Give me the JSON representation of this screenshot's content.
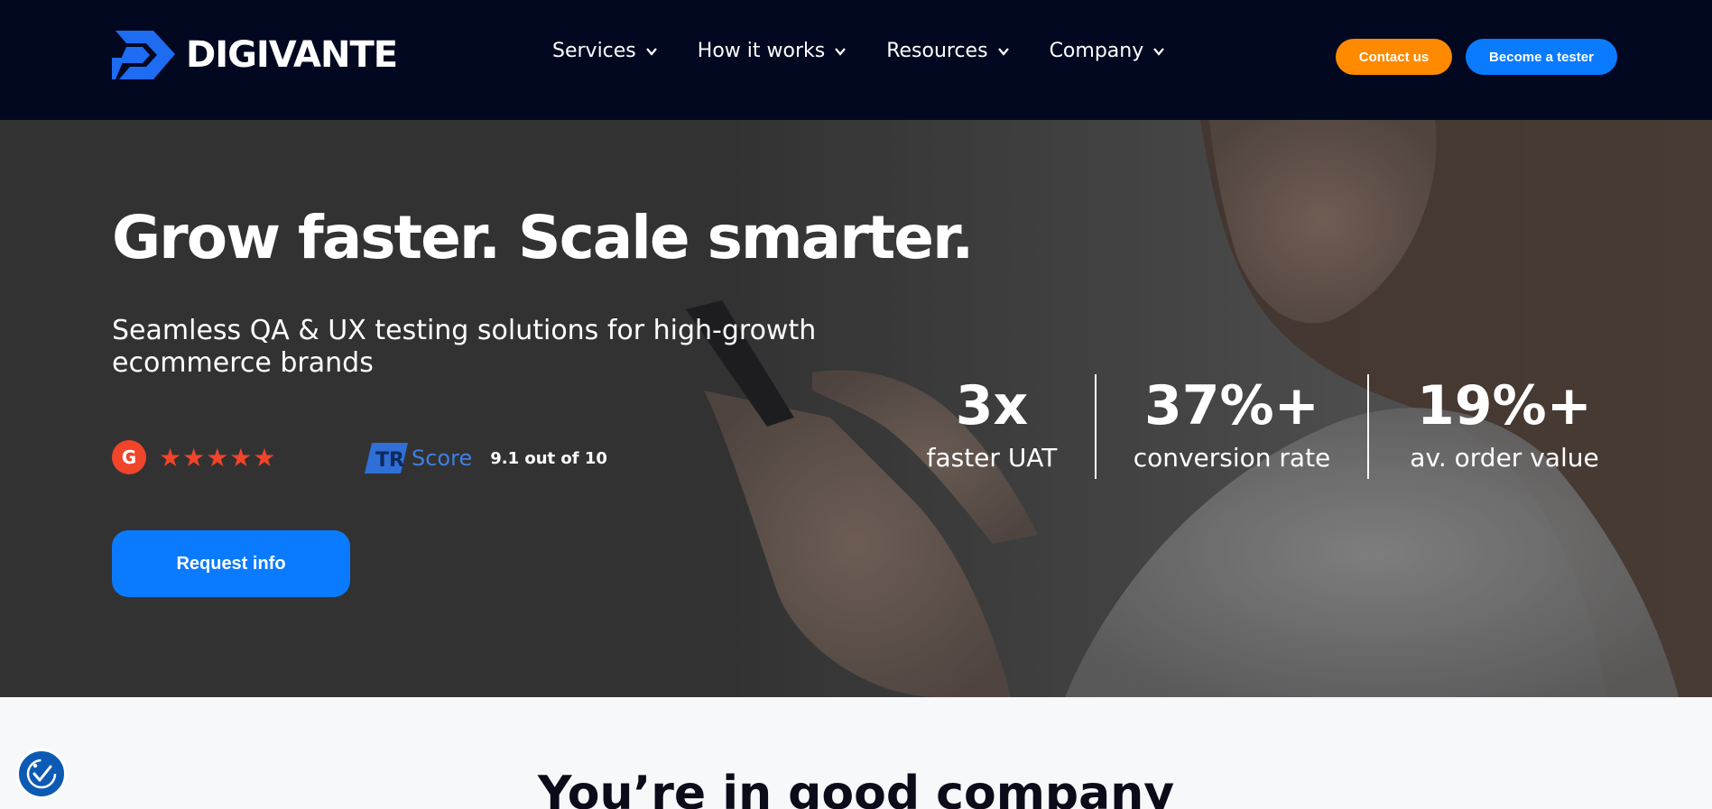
{
  "nav": {
    "logo_text": "DIGIVANTE",
    "menu": [
      {
        "label": "Services"
      },
      {
        "label": "How it works"
      },
      {
        "label": "Resources"
      },
      {
        "label": "Company"
      }
    ],
    "contact_label": "Contact us",
    "tester_label": "Become a tester"
  },
  "hero": {
    "headline": "Grow faster. Scale smarter.",
    "subhead": "Seamless QA & UX testing solutions for high-growth ecommerce brands",
    "g2": {
      "badge": "G",
      "stars": "★★★★★",
      "rating_stars": 5
    },
    "tr": {
      "score_label": "Score",
      "score_text": "9.1 out of 10"
    },
    "request_label": "Request info",
    "stats": [
      {
        "value": "3x",
        "label": "faster UAT"
      },
      {
        "value": "37%+",
        "label": "conversion rate"
      },
      {
        "value": "19%+",
        "label": "av. order value"
      }
    ]
  },
  "lower": {
    "title": "You’re in good company"
  },
  "colors": {
    "nav_bg": "#030821",
    "accent_orange": "#ff8a00",
    "accent_blue": "#0a7bff",
    "g2_red": "#f0442b"
  },
  "icons": [
    "digivante-logo-icon",
    "chevron-down-icon",
    "g2-icon",
    "trustradius-icon",
    "accessibility-icon"
  ]
}
